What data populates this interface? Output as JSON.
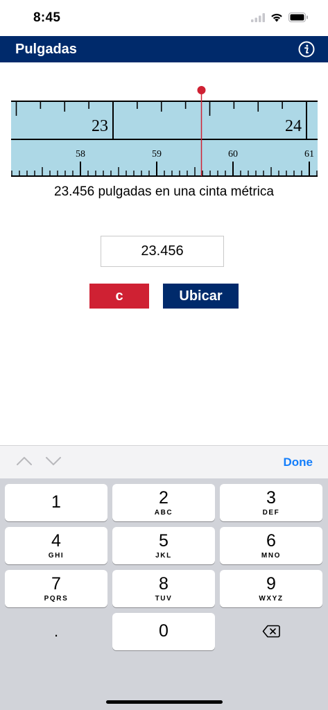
{
  "status": {
    "time": "8:45"
  },
  "nav": {
    "title": "Pulgadas",
    "info_icon": "info-icon"
  },
  "ruler": {
    "inch_labels": [
      "23",
      "24"
    ],
    "cm_labels": [
      "58",
      "59",
      "60",
      "61"
    ],
    "marker_value": 23.456,
    "colors": {
      "tape": "#add8e6",
      "marker": "#cf2133"
    }
  },
  "caption": "23.456 pulgadas en una cinta métrica",
  "input": {
    "value": "23.456"
  },
  "buttons": {
    "clear_label": "c",
    "locate_label": "Ubicar"
  },
  "accessory": {
    "done_label": "Done"
  },
  "keyboard": {
    "keys": [
      {
        "num": "1",
        "letters": ""
      },
      {
        "num": "2",
        "letters": "ABC"
      },
      {
        "num": "3",
        "letters": "DEF"
      },
      {
        "num": "4",
        "letters": "GHI"
      },
      {
        "num": "5",
        "letters": "JKL"
      },
      {
        "num": "6",
        "letters": "MNO"
      },
      {
        "num": "7",
        "letters": "PQRS"
      },
      {
        "num": "8",
        "letters": "TUV"
      },
      {
        "num": "9",
        "letters": "WXYZ"
      },
      {
        "num": "0",
        "letters": ""
      }
    ],
    "decimal": "."
  },
  "colors": {
    "nav": "#002a6b",
    "clear": "#cf2133",
    "link": "#147efb"
  }
}
